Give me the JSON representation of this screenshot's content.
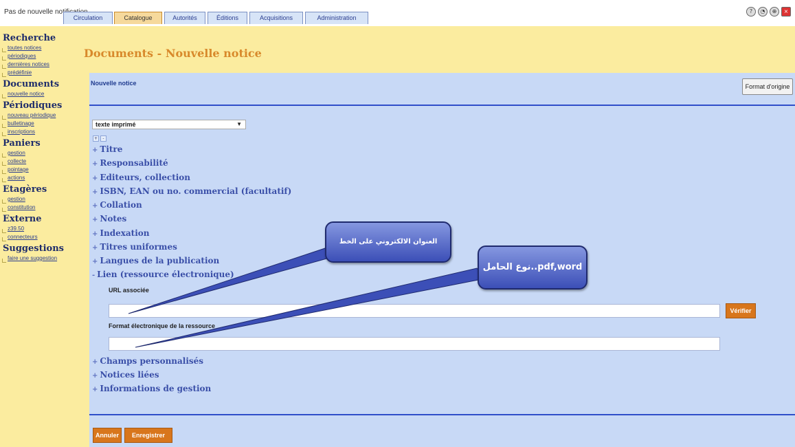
{
  "header": {
    "notification": "Pas de nouvelle notification",
    "tabs": [
      {
        "label": "Circulation"
      },
      {
        "label": "Catalogue"
      },
      {
        "label": "Autorités"
      },
      {
        "label": "Éditions"
      },
      {
        "label": "Acquisitions"
      },
      {
        "label": "Administration"
      }
    ],
    "icons": [
      "help-icon",
      "clock-icon",
      "globe-icon",
      "close-icon"
    ]
  },
  "sidebar": {
    "groups": [
      {
        "title": "Recherche",
        "links": [
          "toutes notices",
          "périodiques",
          "dernières notices",
          "prédéfinie"
        ]
      },
      {
        "title": "Documents",
        "links": [
          "nouvelle notice"
        ]
      },
      {
        "title": "Périodiques",
        "links": [
          "nouveau périodique",
          "bulletinage",
          "inscriptions"
        ]
      },
      {
        "title": "Paniers",
        "links": [
          "gestion",
          "collecte",
          "pointage",
          "actions"
        ]
      },
      {
        "title": "Etagères",
        "links": [
          "gestion",
          "constitution"
        ]
      },
      {
        "title": "Externe",
        "links": [
          "z39.50",
          "connecteurs"
        ]
      },
      {
        "title": "Suggestions",
        "links": [
          "faire une suggestion"
        ]
      }
    ]
  },
  "main": {
    "title": "Documents - Nouvelle notice",
    "subtitle": "Nouvelle notice",
    "format_button": "Format d'origine",
    "doc_type": "texte imprimé",
    "sections": [
      "Titre",
      "Responsabilité",
      "Editeurs, collection",
      "ISBN, EAN ou no. commercial (facultatif)",
      "Collation",
      "Notes",
      "Indexation",
      "Titres uniformes",
      "Langues de la publication",
      "Lien (ressource électronique)"
    ],
    "url_label": "URL associée",
    "url_value": "",
    "verify_button": "Vérifier",
    "format_label": "Format électronique de la ressource",
    "format_value": "",
    "sections_after": [
      "Champs personnalisés",
      "Notices liées",
      "Informations de gestion"
    ],
    "cancel_button": "Annuler",
    "save_button": "Enregistrer"
  },
  "callouts": {
    "url_note": "العنوان الالكتروني على الخط",
    "format_note": "نوع الحامل..pdf,word"
  },
  "colors": {
    "sidebar_bg": "#fbec9f",
    "panel_bg": "#c8d9f6",
    "title_orange": "#d8892b",
    "link_blue": "#2a3d8f",
    "button_orange": "#d8761c"
  }
}
